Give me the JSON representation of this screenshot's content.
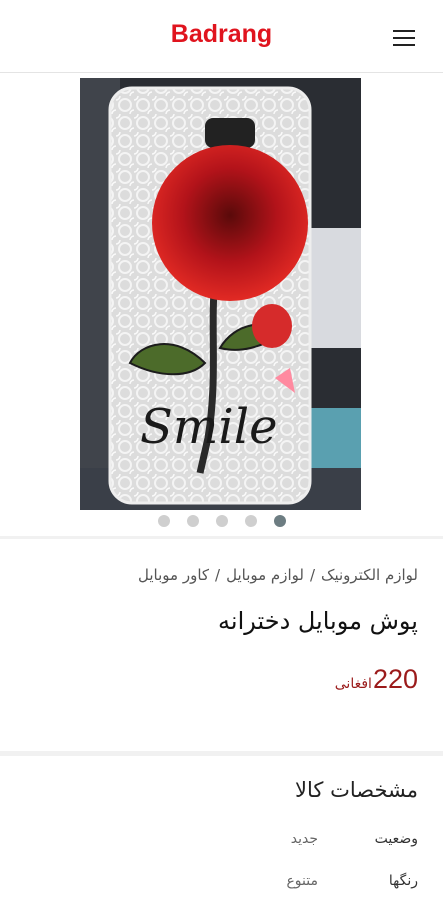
{
  "header": {
    "brand": "Badrang",
    "menu_icon": "hamburger-menu-icon"
  },
  "gallery": {
    "image_subject": "phone case with red fur rose and Smile embroidery",
    "slide_count": 5,
    "active_slide": 5
  },
  "product": {
    "breadcrumb": [
      "لوازم الکترونیک",
      "/",
      "لوازم موبایل",
      "/",
      "کاور موبایل"
    ],
    "title": "پوش موبایل دخترانه",
    "price": "220",
    "currency": "افغانی"
  },
  "specs": {
    "title": "مشخصات کالا",
    "rows": [
      {
        "label": "وضعیت",
        "value": "جدید"
      },
      {
        "label": "رنگها",
        "value": "متنوع"
      }
    ]
  },
  "colors": {
    "brand": "#e0141e",
    "price": "#9b1b1b"
  }
}
